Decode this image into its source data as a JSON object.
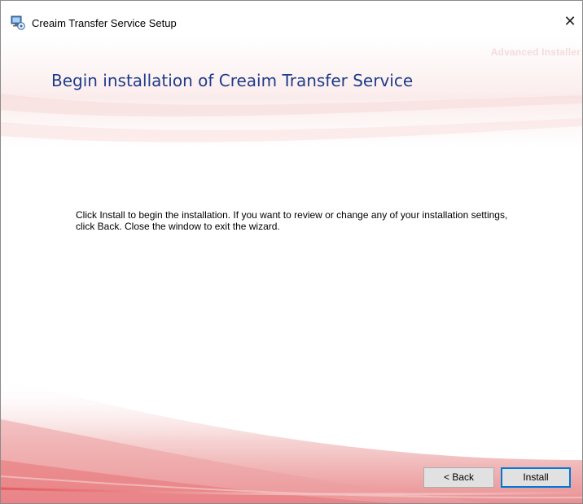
{
  "window": {
    "title": "Creaim Transfer Service Setup",
    "close_glyph": "✕"
  },
  "brand": {
    "watermark": "Advanced Installer"
  },
  "page": {
    "heading": "Begin installation of Creaim Transfer Service",
    "body_line1": "Click Install to begin the installation.  If you want to review or change any of your installation settings,",
    "body_line2": "click Back.  Close the window to exit the wizard."
  },
  "buttons": {
    "back_label": "< Back",
    "install_label": "Install"
  },
  "colors": {
    "heading": "#1f3c8a",
    "accent_swoosh": "#d9272e",
    "default_button_border": "#0078d7"
  },
  "icons": {
    "app": "setup-computer-icon",
    "close": "close-icon"
  }
}
